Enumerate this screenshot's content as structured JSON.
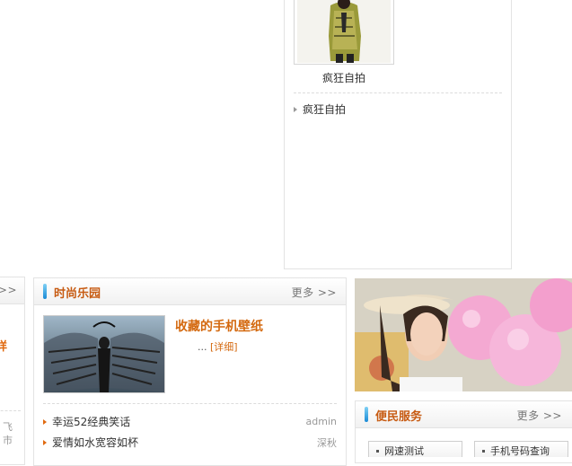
{
  "photo_panel": {
    "caption": "疯狂自拍",
    "list": [
      "疯狂自拍"
    ]
  },
  "left_edge": {
    "more": ">>",
    "frag_orange": "详",
    "frag_mid": "飞",
    "frag_bottom": "市"
  },
  "fashion": {
    "title": "时尚乐园",
    "more": "更多 >>",
    "feature_title": "收藏的手机壁纸",
    "feature_ellipsis": "...",
    "feature_detail": "[详细]",
    "items": [
      {
        "text": "幸运52经典笑话",
        "author": "admin"
      },
      {
        "text": "爱情如水宽容如杯",
        "author": "深秋"
      }
    ]
  },
  "services": {
    "title": "便民服务",
    "more": "更多 >>",
    "buttons": [
      "网速测试",
      "手机号码查询"
    ]
  },
  "colors": {
    "accent": "#c75b12",
    "bar": "#1a8bd6",
    "border": "#e3e3e3"
  }
}
